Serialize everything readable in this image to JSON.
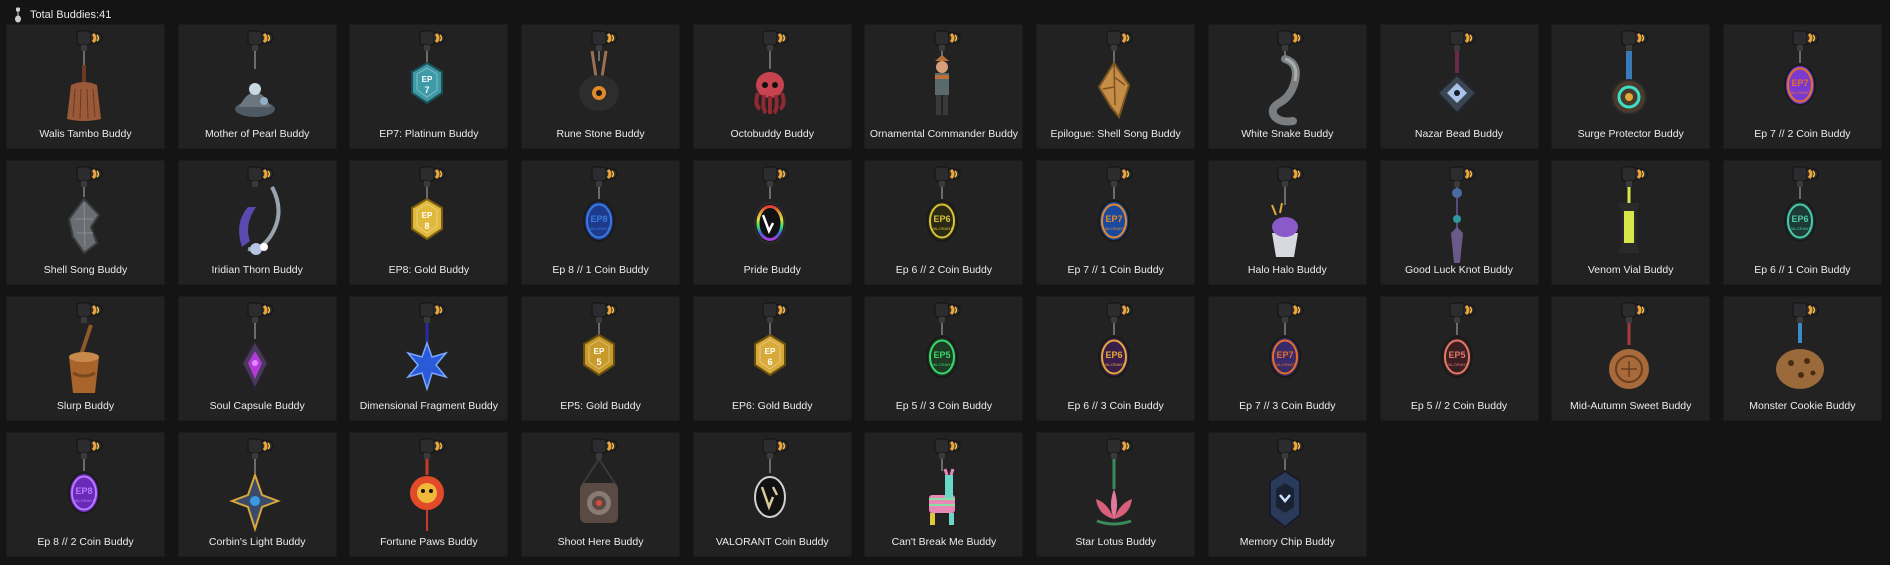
{
  "header": {
    "total_label": "Total Buddies:41",
    "icon": "buddy-charm-icon"
  },
  "buddies": [
    {
      "name": "Walis Tambo Buddy",
      "shape": "broom",
      "color": "#9a5a3a",
      "accent": "#6a3a22",
      "text": ""
    },
    {
      "name": "Mother of Pearl Buddy",
      "shape": "pearl",
      "color": "#4d5a63",
      "accent": "#c9d7df",
      "text": ""
    },
    {
      "name": "EP7: Platinum Buddy",
      "shape": "hexbadge",
      "color": "#3d9aa6",
      "accent": "#1b4f57",
      "text": "EP 7"
    },
    {
      "name": "Rune Stone Buddy",
      "shape": "rune",
      "color": "#2d2d2d",
      "accent": "#e0882a",
      "text": ""
    },
    {
      "name": "Octobuddy Buddy",
      "shape": "octo",
      "color": "#c7434f",
      "accent": "#8f2a33",
      "text": ""
    },
    {
      "name": "Ornamental Commander Buddy",
      "shape": "figure",
      "color": "#b9703a",
      "accent": "#5a6a6a",
      "text": ""
    },
    {
      "name": "Epilogue: Shell Song Buddy",
      "shape": "shellgold",
      "color": "#c58d45",
      "accent": "#7b5523",
      "text": ""
    },
    {
      "name": "White Snake Buddy",
      "shape": "snake",
      "color": "#7a7e80",
      "accent": "#4b4e50",
      "text": ""
    },
    {
      "name": "Nazar Bead Buddy",
      "shape": "nazar",
      "color": "#3c4552",
      "accent": "#a8c4e8",
      "text": ""
    },
    {
      "name": "Surge Protector Buddy",
      "shape": "surge",
      "color": "#4a3a2c",
      "accent": "#3ce0c8",
      "text": ""
    },
    {
      "name": "Ep 7 // 2 Coin Buddy",
      "shape": "coin",
      "color": "#7a3ad0",
      "accent": "#e2702a",
      "text": "EP7"
    },
    {
      "name": "Shell Song Buddy",
      "shape": "shell",
      "color": "#6a6e73",
      "accent": "#3a3d40",
      "text": ""
    },
    {
      "name": "Iridian Thorn Buddy",
      "shape": "thorn",
      "color": "#5a4ab0",
      "accent": "#b8c4e6",
      "text": ""
    },
    {
      "name": "EP8: Gold Buddy",
      "shape": "hexbadge",
      "color": "#e0b83a",
      "accent": "#7a5c14",
      "text": "EP 8"
    },
    {
      "name": "Ep 8 // 1 Coin Buddy",
      "shape": "coin",
      "color": "#1e3a8a",
      "accent": "#3a7ae0",
      "text": "EP8"
    },
    {
      "name": "Pride Buddy",
      "shape": "pride",
      "color": "#111111",
      "accent": "#e03a6a",
      "text": ""
    },
    {
      "name": "Ep 6 // 2 Coin Buddy",
      "shape": "coin",
      "color": "#2a2a14",
      "accent": "#d8c23a",
      "text": "EP6"
    },
    {
      "name": "Ep 7 // 1 Coin Buddy",
      "shape": "coin",
      "color": "#1a4aa0",
      "accent": "#e28a2a",
      "text": "EP7"
    },
    {
      "name": "Halo Halo Buddy",
      "shape": "halo",
      "color": "#8a5ac8",
      "accent": "#d8d8e0",
      "text": ""
    },
    {
      "name": "Good Luck Knot Buddy",
      "shape": "knot",
      "color": "#6a5a8a",
      "accent": "#2a9aa0",
      "text": ""
    },
    {
      "name": "Venom Vial Buddy",
      "shape": "vial",
      "color": "#d8e84a",
      "accent": "#2a2a2a",
      "text": ""
    },
    {
      "name": "Ep 6 // 1 Coin Buddy",
      "shape": "coin",
      "color": "#1e3a36",
      "accent": "#4ac8a8",
      "text": "EP6"
    },
    {
      "name": "Slurp Buddy",
      "shape": "slurp",
      "color": "#a8642a",
      "accent": "#7a4a1e",
      "text": ""
    },
    {
      "name": "Soul Capsule Buddy",
      "shape": "capsule",
      "color": "#b43ad8",
      "accent": "#e08aff",
      "text": ""
    },
    {
      "name": "Dimensional Fragment Buddy",
      "shape": "star",
      "color": "#2a5ad8",
      "accent": "#7aa8ff",
      "text": ""
    },
    {
      "name": "EP5: Gold Buddy",
      "shape": "hexbadge",
      "color": "#c89a2a",
      "accent": "#6a4e10",
      "text": "EP 5"
    },
    {
      "name": "EP6: Gold Buddy",
      "shape": "hexbadge",
      "color": "#d8aa3a",
      "accent": "#6a4e10",
      "text": "EP 6"
    },
    {
      "name": "Ep 5 // 3 Coin Buddy",
      "shape": "coin",
      "color": "#1e3a24",
      "accent": "#3ad86a",
      "text": "EP5"
    },
    {
      "name": "Ep 6 // 3 Coin Buddy",
      "shape": "coin",
      "color": "#3a1e4a",
      "accent": "#e2a83a",
      "text": "EP6"
    },
    {
      "name": "Ep 7 // 3 Coin Buddy",
      "shape": "coin",
      "color": "#3a2a6a",
      "accent": "#e2702a",
      "text": "EP7"
    },
    {
      "name": "Ep 5 // 2 Coin Buddy",
      "shape": "coin",
      "color": "#3a1e22",
      "accent": "#e27a6a",
      "text": "EP5"
    },
    {
      "name": "Mid-Autumn Sweet Buddy",
      "shape": "mooncake",
      "color": "#a86a3a",
      "accent": "#6a3e1e",
      "text": ""
    },
    {
      "name": "Monster Cookie Buddy",
      "shape": "cookie",
      "color": "#9a6a3a",
      "accent": "#3a8ac8",
      "text": ""
    },
    {
      "name": "Ep 8 // 2 Coin Buddy",
      "shape": "coin",
      "color": "#6a2ab8",
      "accent": "#b87aff",
      "text": "EP8"
    },
    {
      "name": "Corbin's Light Buddy",
      "shape": "corbin",
      "color": "#3a4a6a",
      "accent": "#d8a83a",
      "text": ""
    },
    {
      "name": "Fortune Paws Buddy",
      "shape": "lion",
      "color": "#e24a2a",
      "accent": "#f0b83a",
      "text": ""
    },
    {
      "name": "Shoot Here Buddy",
      "shape": "target",
      "color": "#5a4a44",
      "accent": "#e04a3a",
      "text": ""
    },
    {
      "name": "VALORANT Coin Buddy",
      "shape": "valcoin",
      "color": "#111111",
      "accent": "#d8c89a",
      "text": ""
    },
    {
      "name": "Can't Break Me Buddy",
      "shape": "pinata",
      "color": "#e88ab8",
      "accent": "#6ad8c8",
      "text": ""
    },
    {
      "name": "Star Lotus Buddy",
      "shape": "lotus",
      "color": "#e07a9a",
      "accent": "#3a8a5a",
      "text": ""
    },
    {
      "name": "Memory Chip Buddy",
      "shape": "chip",
      "color": "#2a3a5a",
      "accent": "#cfe4ff",
      "text": ""
    }
  ]
}
